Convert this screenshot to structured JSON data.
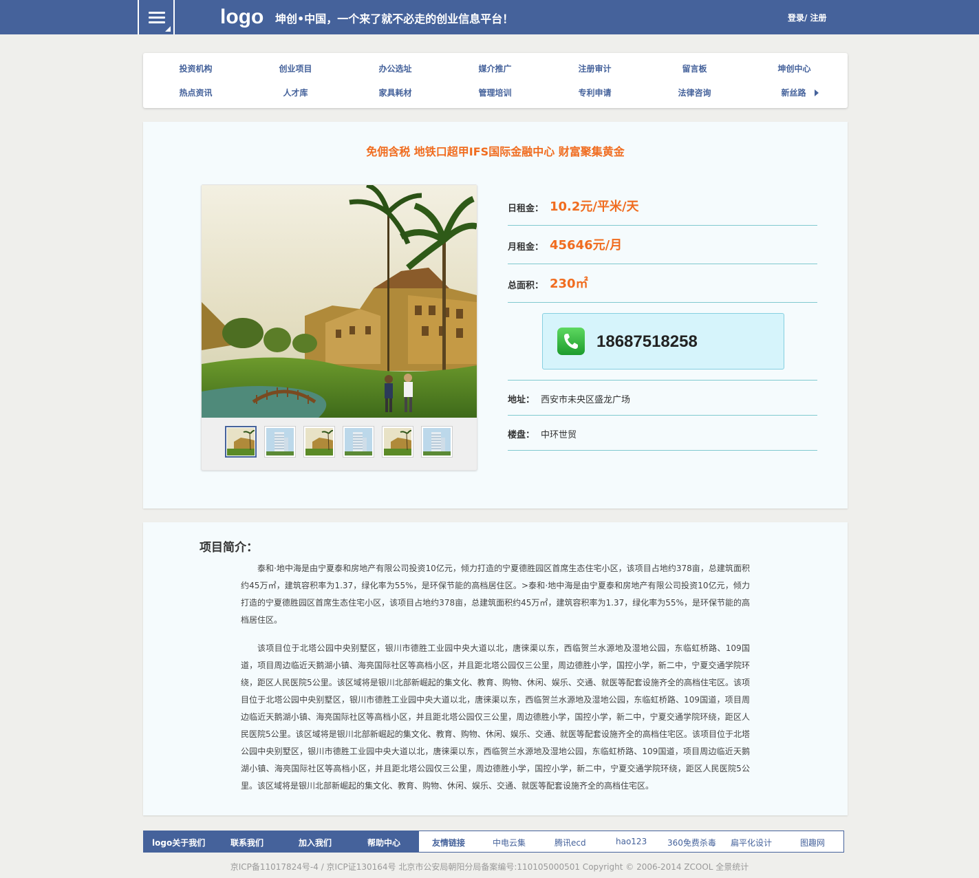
{
  "header": {
    "logo": "logo",
    "slogan": "坤创•中国，一个来了就不必走的创业信息平台！",
    "auth": "登录/ 注册"
  },
  "nav": {
    "row1": [
      "投资机构",
      "创业项目",
      "办公选址",
      "媒介推广",
      "注册审计",
      "留言板",
      "坤创中心"
    ],
    "row2": [
      "热点资讯",
      "人才库",
      "家具耗材",
      "管理培训",
      "专利申请",
      "法律咨询",
      "新丝路"
    ]
  },
  "detail": {
    "title": "免佣含税 地铁口超甲IFS国际金融中心 财富聚集黄金",
    "daily_rent_label": "日租金：",
    "daily_rent_value": "10.2元/平米/天",
    "monthly_rent_label": "月租金：",
    "monthly_rent_value": "45646元/月",
    "area_label": "总面积：",
    "area_value": "230㎡",
    "phone": "18687518258",
    "address_label": "地址：",
    "address_value": "西安市未央区盛龙广场",
    "building_label": "楼盘：",
    "building_value": "中环世贸"
  },
  "intro": {
    "title": "项目简介：",
    "p1": "泰和·地中海是由宁夏泰和房地产有限公司投资10亿元，倾力打造的宁夏德胜园区首席生态住宅小区，该项目占地约378亩，总建筑面积约45万㎡，建筑容积率为1.37，绿化率为55%，是环保节能的高档居住区。>泰和·地中海是由宁夏泰和房地产有限公司投资10亿元，倾力打造的宁夏德胜园区首席生态住宅小区，该项目占地约378亩，总建筑面积约45万㎡，建筑容积率为1.37，绿化率为55%，是环保节能的高档居住区。",
    "p2": "该项目位于北塔公园中央别墅区，银川市德胜工业园中央大道以北，唐徕渠以东，西临贺兰水源地及湿地公园，东临虹桥路、109国道，项目周边临近天鹅湖小镇、海亮国际社区等高档小区，并且距北塔公园仅三公里，周边德胜小学，国控小学，新二中，宁夏交通学院环绕，距区人民医院5公里。该区域将是银川北部新崛起的集文化、教育、购物、休闲、娱乐、交通、就医等配套设施齐全的高档住宅区。该项目位于北塔公园中央别墅区，银川市德胜工业园中央大道以北，唐徕渠以东，西临贺兰水源地及湿地公园，东临虹桥路、109国道，项目周边临近天鹅湖小镇、海亮国际社区等高档小区，并且距北塔公园仅三公里，周边德胜小学，国控小学，新二中，宁夏交通学院环绕，距区人民医院5公里。该区域将是银川北部新崛起的集文化、教育、购物、休闲、娱乐、交通、就医等配套设施齐全的高档住宅区。该项目位于北塔公园中央别墅区，银川市德胜工业园中央大道以北，唐徕渠以东，西临贺兰水源地及湿地公园，东临虹桥路、109国道，项目周边临近天鹅湖小镇、海亮国际社区等高档小区，并且距北塔公园仅三公里，周边德胜小学，国控小学，新二中，宁夏交通学院环绕，距区人民医院5公里。该区域将是银川北部新崛起的集文化、教育、购物、休闲、娱乐、交通、就医等配套设施齐全的高档住宅区。"
  },
  "footer": {
    "left": [
      "logo关于我们",
      "联系我们",
      "加入我们",
      "帮助中心"
    ],
    "friend_label": "友情链接",
    "links": [
      "中电云集",
      "腾讯ecd",
      "hao123",
      "360免费杀毒",
      "扁平化设计",
      "图趣网"
    ],
    "copyright": "京ICP备11017824号-4 / 京ICP证130164号 北京市公安局朝阳分局备案编号:110105000501 Copyright © 2006-2014 ZCOOL 全景统计"
  },
  "colors": {
    "brand": "#45629b",
    "accent": "#f06c1f",
    "panel": "#f5fbfd",
    "divider": "#7fc9cf"
  },
  "icons": [
    "menu-icon",
    "phone-icon",
    "chevron-right-icon"
  ]
}
